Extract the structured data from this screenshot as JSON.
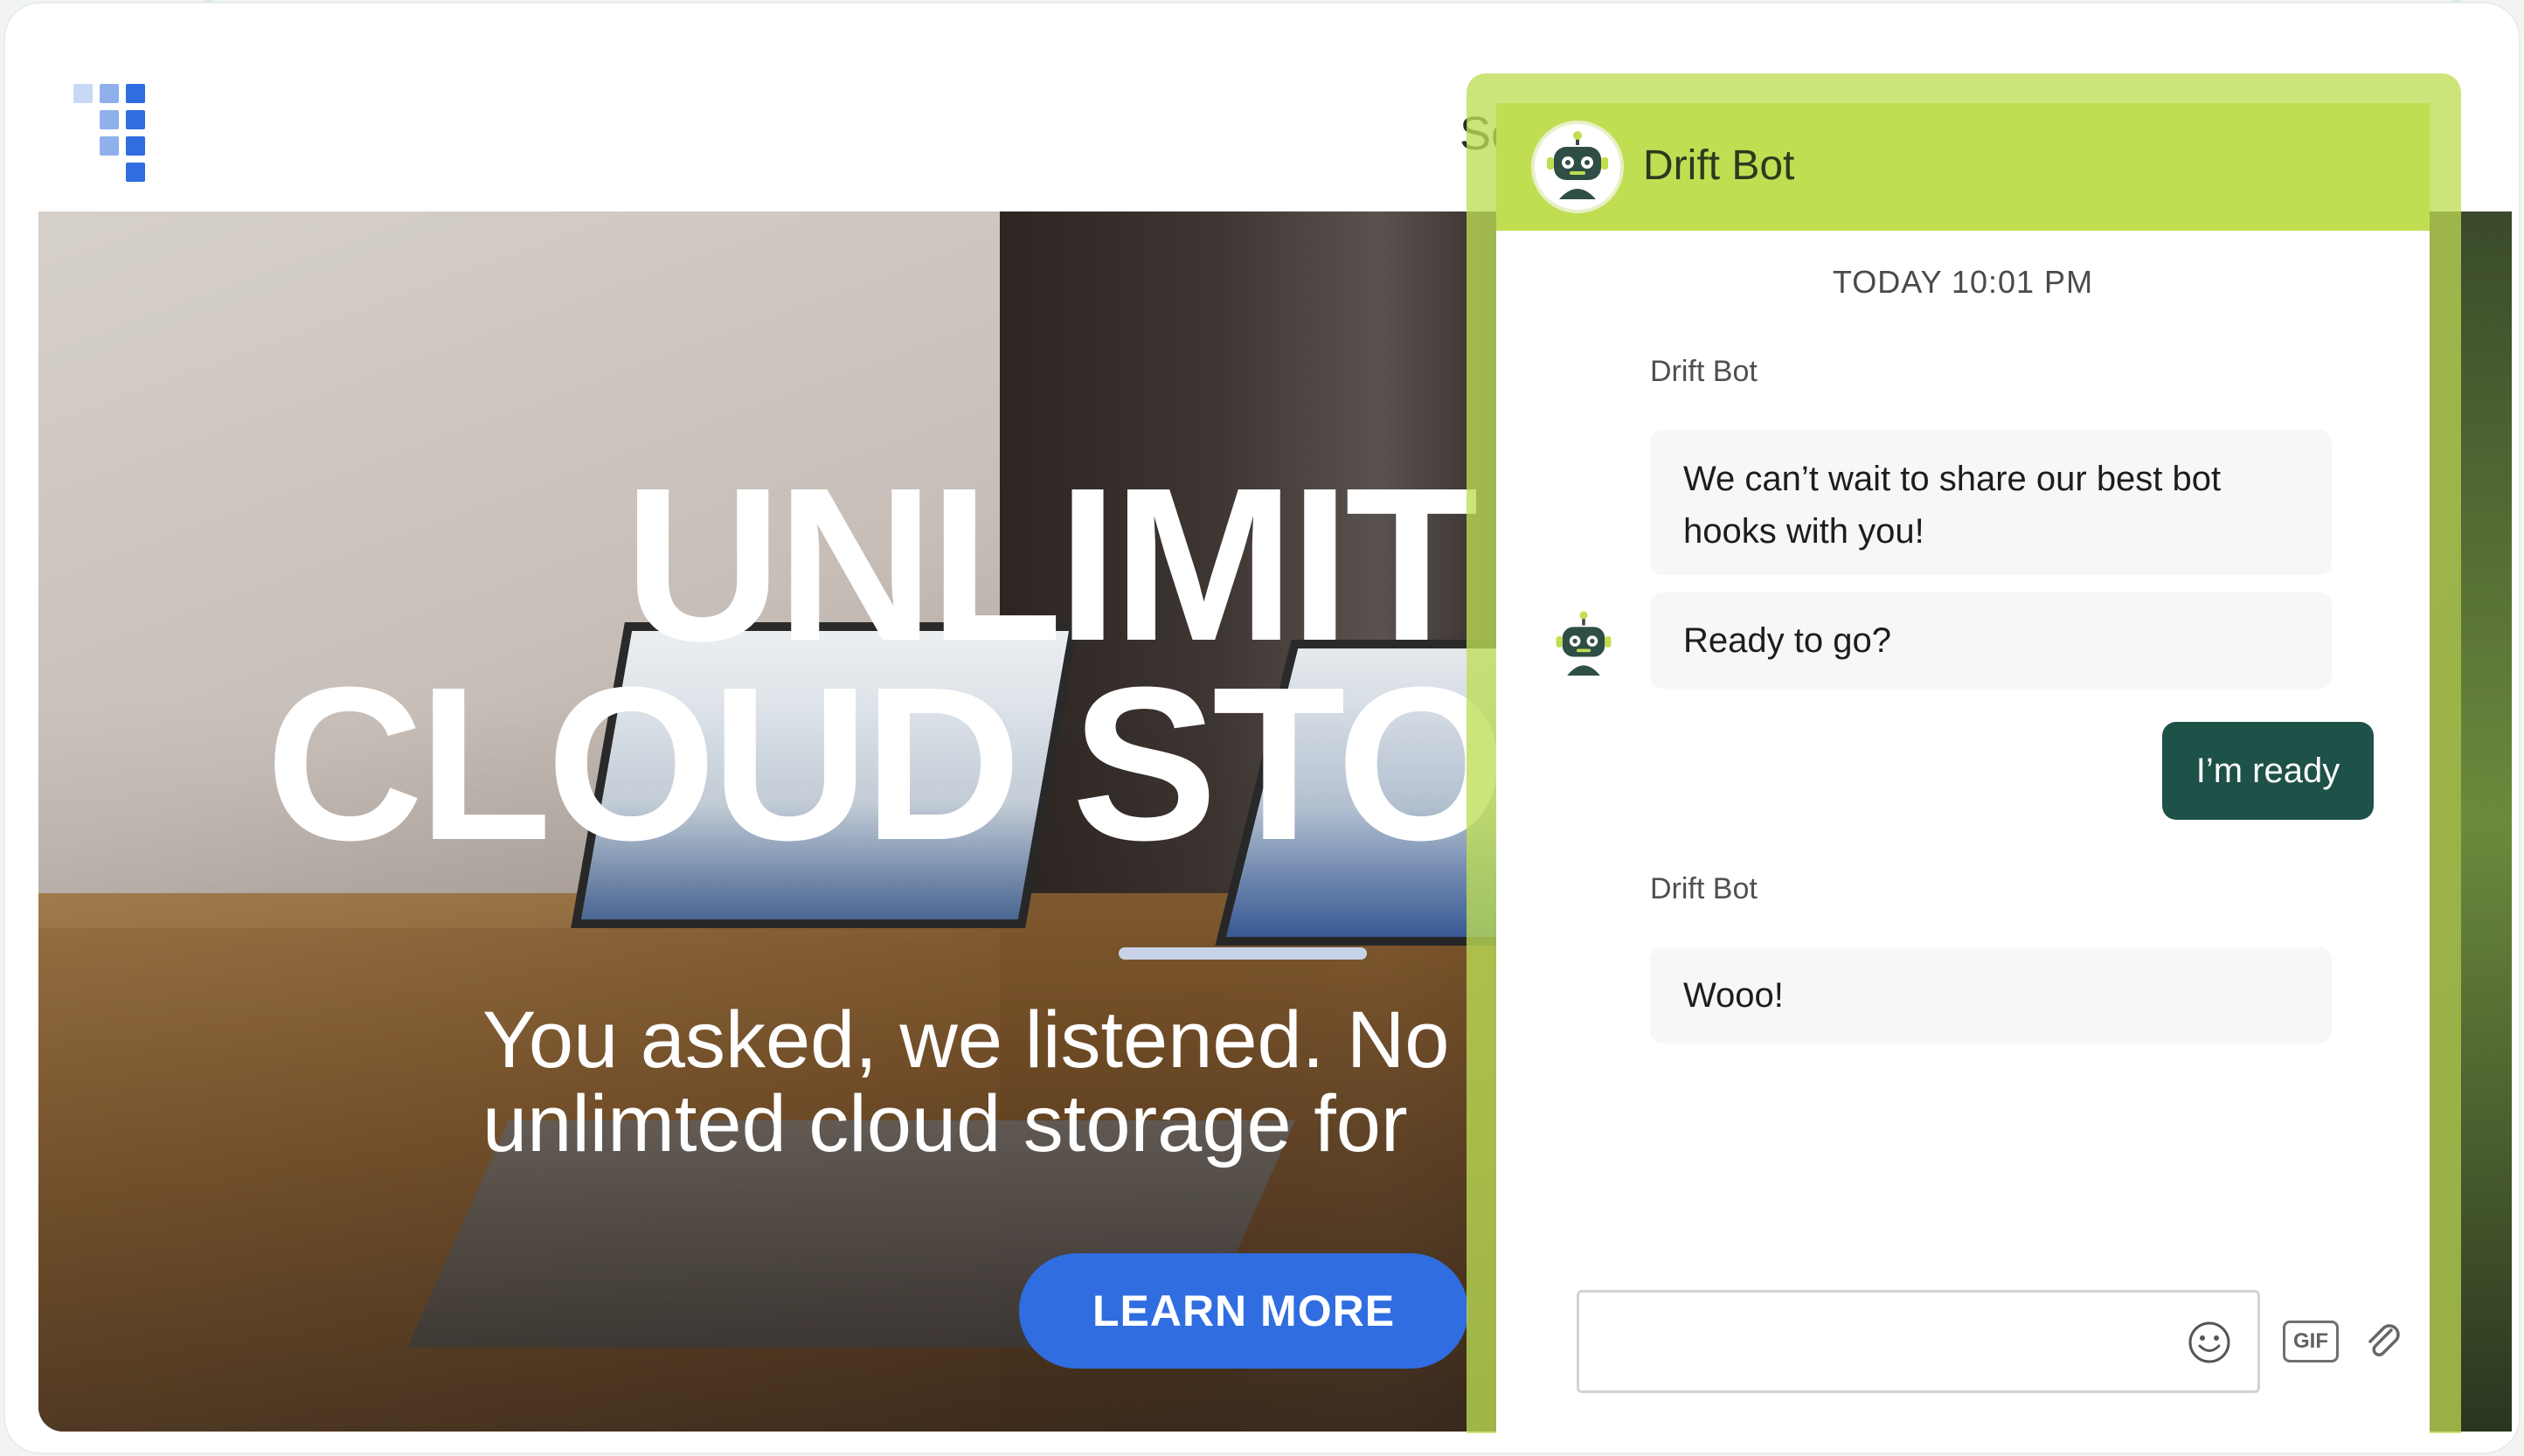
{
  "site": {
    "nav_fragment": "Sc",
    "hero": {
      "title_line1": "UNLIMIT",
      "title_line2": "CLOUD STO",
      "subtitle_line1": "You asked, we listened. No",
      "subtitle_line2": "unlimted cloud storage for",
      "cta_label": "LEARN MORE"
    }
  },
  "chat": {
    "header_title": "Drift Bot",
    "timestamp": "TODAY 10:01 PM",
    "messages": [
      {
        "sender": "Drift Bot",
        "text": "We can’t wait to share our best bot hooks with you!"
      },
      {
        "text": "Ready to go?"
      },
      {
        "sender": "Drift Bot",
        "text": "Wooo!"
      }
    ],
    "reply_option": "I’m ready",
    "composer": {
      "placeholder": "",
      "gif_label": "GIF"
    }
  },
  "colors": {
    "chat_header": "#c0de52",
    "reply_button": "#1e5148",
    "cta_button": "#2f6de0",
    "logo_blue": "#2f6de0"
  },
  "icons": {
    "logo": "grid-logo-icon",
    "bot": "robot-avatar-icon",
    "emoji": "smiley-icon",
    "attach": "paperclip-icon"
  }
}
